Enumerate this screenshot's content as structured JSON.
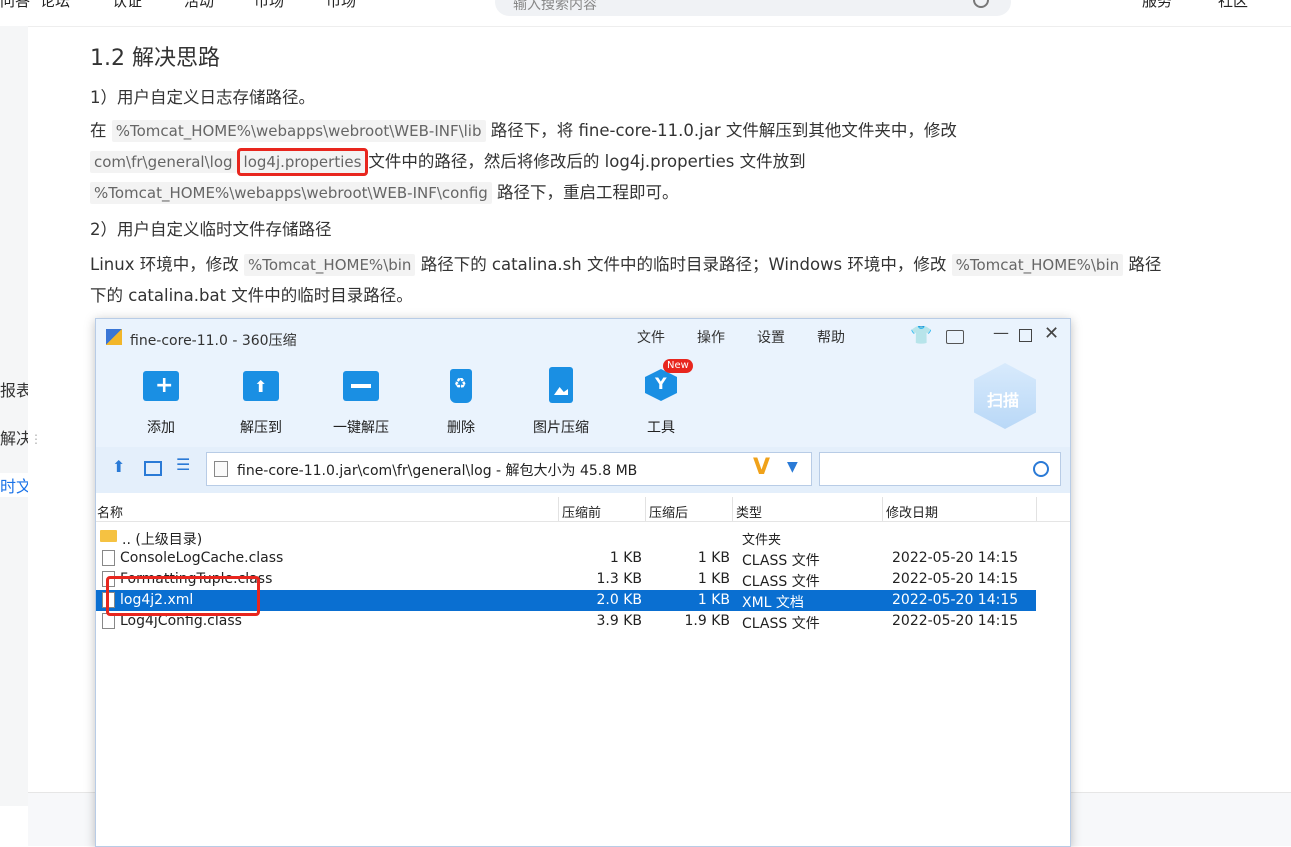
{
  "topnav": {
    "items": [
      "问答",
      "论坛",
      "认证",
      "活动",
      "市场"
    ],
    "right_items": [
      "服务",
      "社区"
    ],
    "search_placeholder": "输入搜索内容"
  },
  "sidebar": {
    "fragments": [
      "报表E",
      "解决",
      "时文"
    ]
  },
  "article": {
    "heading": "1.2 解决思路",
    "step1_title": "1）用户自定义日志存储路径。",
    "step1_l1_a": "在",
    "step1_l1_code": "%Tomcat_HOME%\\webapps\\webroot\\WEB-INF\\lib",
    "step1_l1_b": "路径下，将 fine-core-11.0.jar 文件解压到其他文件夹中，修改",
    "step1_l2_code1": "com\\fr\\general\\log",
    "step1_l2_code2": "log4j.properties",
    "step1_l2_b": "文件中的路径，然后将修改后的 log4j.properties 文件放到",
    "step1_l3_code": "%Tomcat_HOME%\\webapps\\webroot\\WEB-INF\\config",
    "step1_l3_b": "路径下，重启工程即可。",
    "step2_title": "2）用户自定义临时文件存储路径",
    "step2_l1_a": "Linux 环境中，修改",
    "step2_l1_code": "%Tomcat_HOME%\\bin",
    "step2_l1_b": "路径下的 catalina.sh 文件中的临时目录路径；Windows 环境中，修改",
    "step2_l1_code2": "%Tomcat_HOME%\\bin",
    "step2_l1_c": "路径",
    "step2_l2": "下的 catalina.bat 文件中的临时目录路径。"
  },
  "window": {
    "title": "fine-core-11.0 - 360压缩",
    "menu": [
      "文件",
      "操作",
      "设置",
      "帮助"
    ],
    "toolbar": [
      {
        "label": "添加",
        "icon": "add-icon"
      },
      {
        "label": "解压到",
        "icon": "extract-to-icon"
      },
      {
        "label": "一键解压",
        "icon": "one-click-extract-icon"
      },
      {
        "label": "删除",
        "icon": "delete-icon"
      },
      {
        "label": "图片压缩",
        "icon": "image-compress-icon"
      },
      {
        "label": "工具",
        "icon": "tools-icon"
      }
    ],
    "new_badge": "New",
    "scan_label": "扫描",
    "address": "fine-core-11.0.jar\\com\\fr\\general\\log - 解包大小为 45.8 MB",
    "columns": [
      "名称",
      "压缩前",
      "压缩后",
      "类型",
      "修改日期"
    ],
    "rows": [
      {
        "name": ".. (上级目录)",
        "before": "",
        "after": "",
        "type": "文件夹",
        "date": "",
        "kind": "folder"
      },
      {
        "name": "ConsoleLogCache.class",
        "before": "1 KB",
        "after": "1 KB",
        "type": "CLASS 文件",
        "date": "2022-05-20 14:15",
        "kind": "file"
      },
      {
        "name": "FormattingTuple.class",
        "before": "1.3 KB",
        "after": "1 KB",
        "type": "CLASS 文件",
        "date": "2022-05-20 14:15",
        "kind": "file"
      },
      {
        "name": "log4j2.xml",
        "before": "2.0 KB",
        "after": "1 KB",
        "type": "XML 文档",
        "date": "2022-05-20 14:15",
        "kind": "file",
        "selected": true
      },
      {
        "name": "Log4jConfig.class",
        "before": "3.9 KB",
        "after": "1.9 KB",
        "type": "CLASS 文件",
        "date": "2022-05-20 14:15",
        "kind": "file"
      }
    ]
  },
  "colors": {
    "accent_blue": "#1a8fe3",
    "selection": "#0a6fd1",
    "highlight_red": "#e8261e"
  }
}
